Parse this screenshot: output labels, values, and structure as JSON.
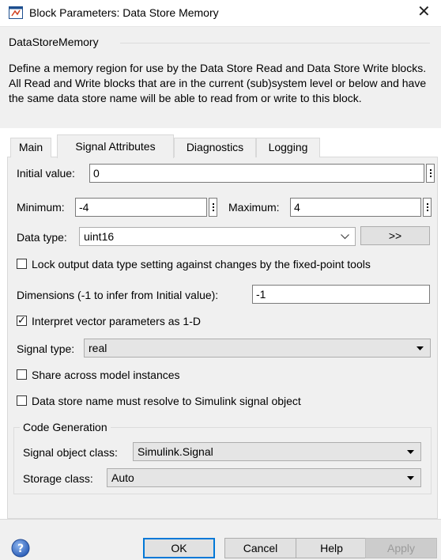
{
  "window": {
    "title": "Block Parameters: Data Store Memory",
    "close_glyph": "✕"
  },
  "header": {
    "block_name": "DataStoreMemory",
    "description": "Define a memory region for use by the Data Store Read and Data Store Write blocks. All Read and Write blocks that are in the current (sub)system level or below and have the same data store name will be able to read from or write to this block."
  },
  "tabs": [
    {
      "label": "Main",
      "active": false
    },
    {
      "label": "Signal Attributes",
      "active": true
    },
    {
      "label": "Diagnostics",
      "active": false
    },
    {
      "label": "Logging",
      "active": false
    }
  ],
  "form": {
    "initial_value_label": "Initial value:",
    "initial_value": "0",
    "minimum_label": "Minimum:",
    "minimum": "-4",
    "maximum_label": "Maximum:",
    "maximum": "4",
    "data_type_label": "Data type:",
    "data_type": "uint16",
    "assistant_button": ">>",
    "lock_label": "Lock output data type setting against changes by the fixed-point tools",
    "lock_checked": false,
    "dimensions_label": "Dimensions (-1 to infer from Initial value):",
    "dimensions": "-1",
    "interpret_label": "Interpret vector parameters as 1-D",
    "interpret_checked": true,
    "signal_type_label": "Signal type:",
    "signal_type": "real",
    "share_label": "Share across model instances",
    "share_checked": false,
    "resolve_label": "Data store name must resolve to Simulink signal object",
    "resolve_checked": false
  },
  "code_generation": {
    "group_label": "Code Generation",
    "signal_object_class_label": "Signal object class:",
    "signal_object_class": "Simulink.Signal",
    "storage_class_label": "Storage class:",
    "storage_class": "Auto"
  },
  "footer": {
    "ok": "OK",
    "cancel": "Cancel",
    "help": "Help",
    "apply": "Apply"
  },
  "colors": {
    "accent": "#0078d7",
    "panel": "#f0f0f0",
    "help_icon": "#3a6fc8"
  },
  "icons": {
    "title": "simulink-block-icon",
    "help": "help-question-icon",
    "dropdown": "chevron-down-icon",
    "dropdown_solid": "triangle-down-icon",
    "ellipsis": "vertical-ellipsis-icon"
  }
}
